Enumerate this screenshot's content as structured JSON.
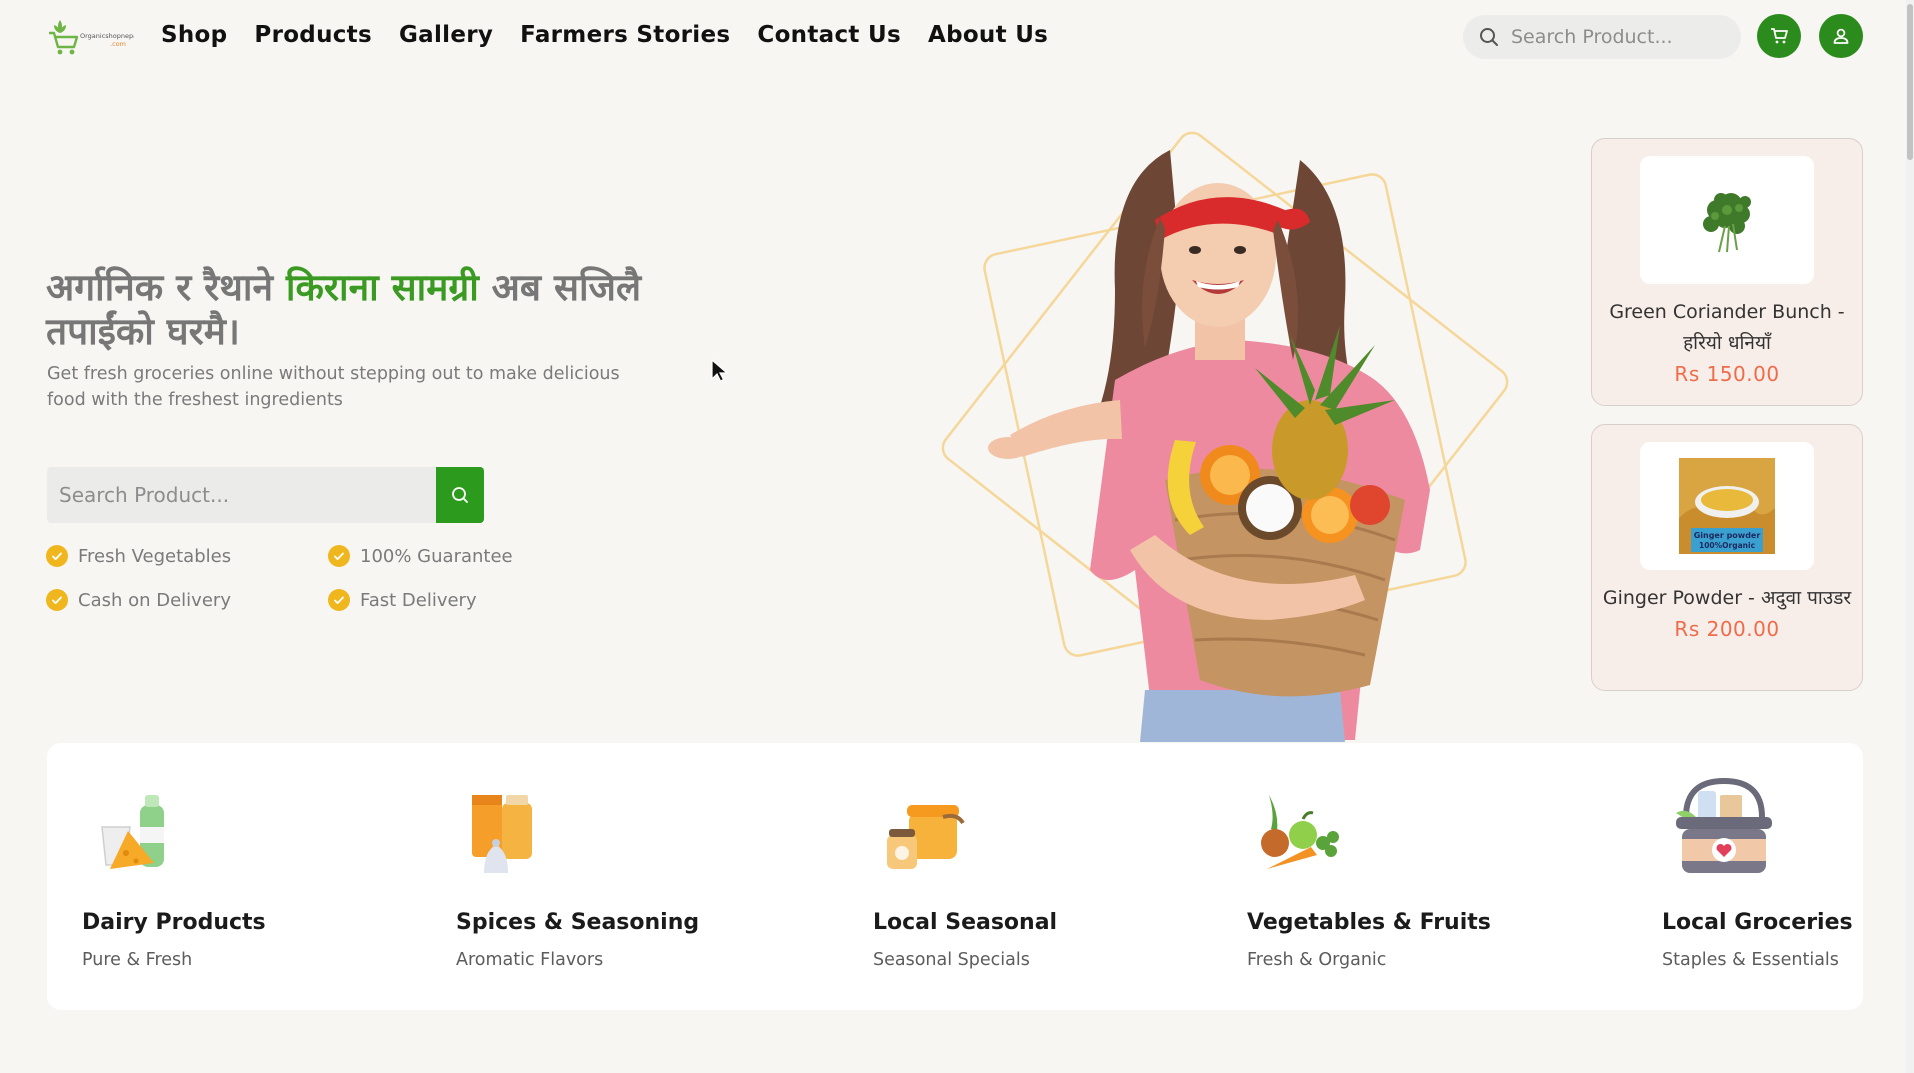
{
  "brand": {
    "logo_text": "Organicshopnepal",
    "logo_sub": ".com",
    "accent": "#2c8b1d",
    "highlight": "#3a9a22",
    "star": "#f0b61e",
    "price": "#ef6c4a"
  },
  "nav": {
    "items": [
      {
        "label": "Shop"
      },
      {
        "label": "Products"
      },
      {
        "label": "Gallery"
      },
      {
        "label": "Farmers Stories"
      },
      {
        "label": "Contact Us"
      },
      {
        "label": "About Us"
      }
    ]
  },
  "header": {
    "search_placeholder": "Search Product...",
    "search_icon": "search-icon",
    "cart_icon": "cart-icon",
    "user_icon": "user-icon"
  },
  "hero": {
    "title_part1": "अर्गानिक र रैथाने ",
    "title_highlight": "किराना सामग्री",
    "title_part2": " अब सजिलै तपाईंको घरमै।",
    "subtitle": "Get fresh groceries online without stepping out to make delicious food with the freshest ingredients",
    "search_placeholder": "Search Product...",
    "features": [
      {
        "label": "Fresh Vegetables"
      },
      {
        "label": "100% Guarantee"
      },
      {
        "label": "Cash on Delivery"
      },
      {
        "label": "Fast Delivery"
      }
    ]
  },
  "product_cards": [
    {
      "name": "Green Coriander Bunch - हरियो धनियाँ",
      "price": "Rs  150.00",
      "image": "coriander-image"
    },
    {
      "name": "Ginger Powder - अदुवा पाउडर",
      "price": "Rs  200.00",
      "image": "ginger-powder-image",
      "image_caption": "Ginger powder 100%Organic"
    }
  ],
  "categories": [
    {
      "name": "Dairy Products",
      "sub": "Pure & Fresh",
      "icon": "dairy-icon"
    },
    {
      "name": "Spices & Seasoning",
      "sub": "Aromatic Flavors",
      "icon": "spices-icon"
    },
    {
      "name": "Local Seasonal",
      "sub": "Seasonal Specials",
      "icon": "seasonal-jars-icon"
    },
    {
      "name": "Vegetables & Fruits",
      "sub": "Fresh & Organic",
      "icon": "vegetables-icon"
    },
    {
      "name": "Local Groceries",
      "sub": "Staples & Essentials",
      "icon": "grocery-basket-icon"
    }
  ]
}
